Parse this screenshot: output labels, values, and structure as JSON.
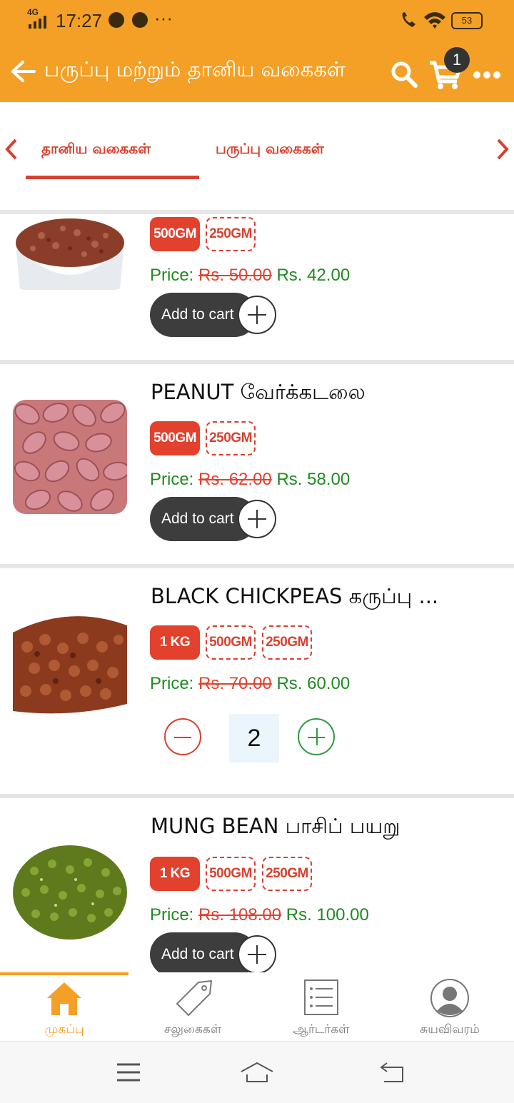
{
  "status_bar": {
    "network": "4G",
    "time": "17:27",
    "more": "···",
    "battery": "53"
  },
  "app_bar": {
    "title": "பருப்பு மற்றும் தானிய வகைகள்",
    "cart_count": "1",
    "accent_color": "#f4a026"
  },
  "tabs": [
    {
      "label": "தானிய வகைகள்",
      "selected": true
    },
    {
      "label": "பருப்பு வகைகள்",
      "selected": false
    }
  ],
  "price_prefix": "Price:",
  "add_to_cart_label": "Add to cart",
  "products": [
    {
      "name": "",
      "variants": [
        {
          "label": "500GM",
          "selected": true
        },
        {
          "label": "250GM",
          "selected": false
        }
      ],
      "old_price": "Rs. 50.00",
      "price": "Rs. 42.00"
    },
    {
      "name": "PEANUT வேர்க்கடலை",
      "variants": [
        {
          "label": "500GM",
          "selected": true
        },
        {
          "label": "250GM",
          "selected": false
        }
      ],
      "old_price": "Rs. 62.00",
      "price": "Rs. 58.00"
    },
    {
      "name": "BLACK CHICKPEAS கருப்பு ...",
      "variants": [
        {
          "label": "1 KG",
          "selected": true
        },
        {
          "label": "500GM",
          "selected": false
        },
        {
          "label": "250GM",
          "selected": false
        }
      ],
      "old_price": "Rs. 70.00",
      "price": "Rs. 60.00",
      "quantity": "2"
    },
    {
      "name": "MUNG BEAN பாசிப் பயறு",
      "variants": [
        {
          "label": "1 KG",
          "selected": true
        },
        {
          "label": "500GM",
          "selected": false
        },
        {
          "label": "250GM",
          "selected": false
        }
      ],
      "old_price": "Rs. 108.00",
      "price": "Rs. 100.00"
    }
  ],
  "bottom_nav": [
    {
      "label": "முகப்பு",
      "icon": "home-icon",
      "active": true
    },
    {
      "label": "சலுகைகள்",
      "icon": "tag-icon",
      "active": false
    },
    {
      "label": "ஆர்டர்கள்",
      "icon": "list-icon",
      "active": false
    },
    {
      "label": "சுயவிவரம்",
      "icon": "user-icon",
      "active": false
    }
  ]
}
